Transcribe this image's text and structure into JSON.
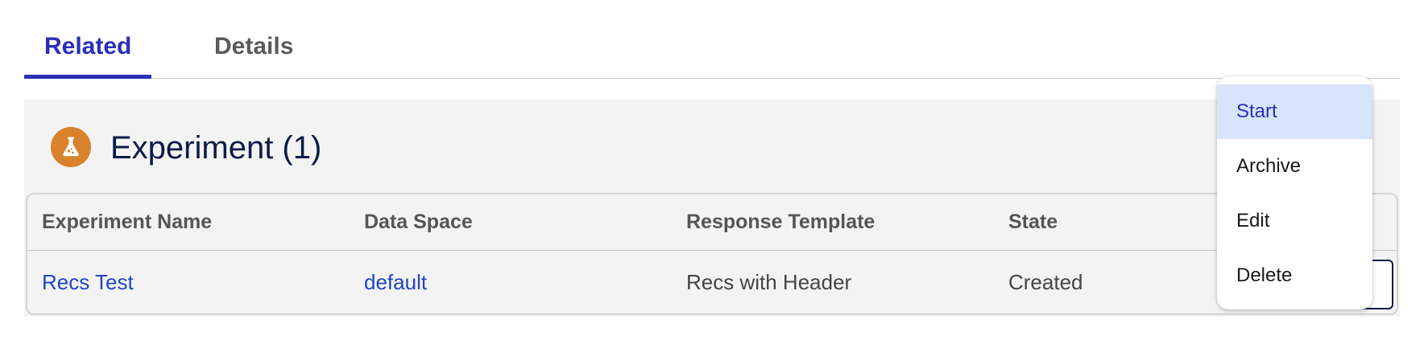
{
  "tabs": [
    {
      "label": "Related",
      "active": true
    },
    {
      "label": "Details",
      "active": false
    }
  ],
  "related": {
    "icon": "flask-icon",
    "title": "Experiment (1)",
    "table": {
      "columns": [
        "Experiment Name",
        "Data Space",
        "Response Template",
        "State"
      ],
      "rows": [
        {
          "name": "Recs Test",
          "data_space": "default",
          "response_template": "Recs with Header",
          "state": "Created"
        }
      ]
    }
  },
  "menu": {
    "items": [
      "Start",
      "Archive",
      "Edit",
      "Delete"
    ],
    "selected": "Start"
  },
  "colors": {
    "accent": "#2a2fb8",
    "link": "#2045c7",
    "icon_bg": "#d9822b",
    "title": "#0d1b48",
    "menu_highlight": "#d8e4fb"
  }
}
